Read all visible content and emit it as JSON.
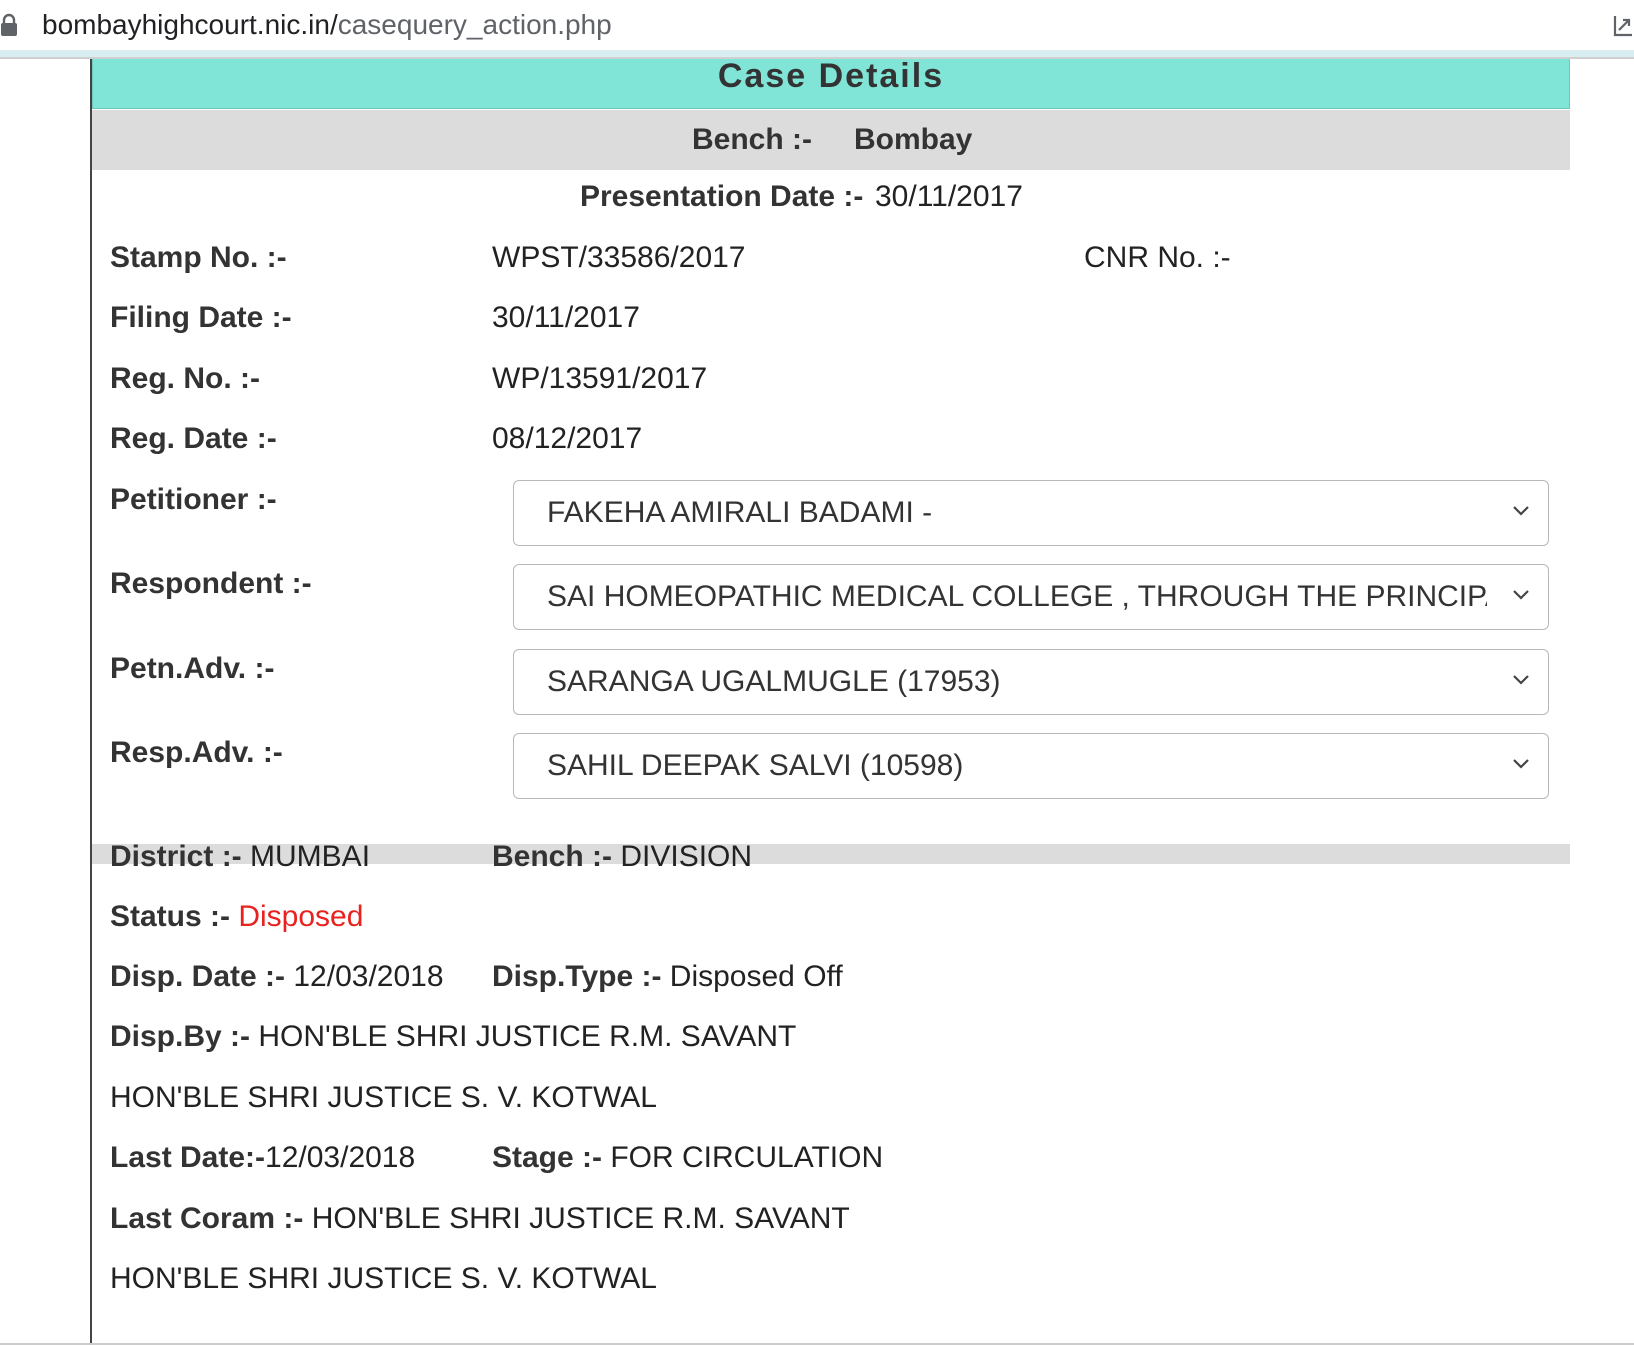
{
  "browser": {
    "url_host": "bombayhighcourt.nic.in/",
    "url_path": "casequery_action.php"
  },
  "page": {
    "title": "Case Details",
    "bench_label": "Bench :-",
    "bench_value": "Bombay",
    "presentation_date_label": "Presentation Date :-",
    "presentation_date_value": "30/11/2017"
  },
  "case": {
    "stamp_no_label": "Stamp No. :-",
    "stamp_no_value": "WPST/33586/2017",
    "cnr_no_label": "CNR No. :-",
    "filing_date_label": "Filing Date :-",
    "filing_date_value": "30/11/2017",
    "reg_no_label": "Reg. No. :-",
    "reg_no_value": "WP/13591/2017",
    "reg_date_label": "Reg. Date :-",
    "reg_date_value": "08/12/2017"
  },
  "parties": {
    "petitioner_label": "Petitioner :-",
    "petitioner_selected": "FAKEHA AMIRALI BADAMI -",
    "respondent_label": "Respondent :-",
    "respondent_selected": "SAI HOMEOPATHIC MEDICAL COLLEGE , THROUGH THE PRINCIPAL",
    "petn_adv_label": "Petn.Adv. :-",
    "petn_adv_selected": "SARANGA UGALMUGLE (17953)",
    "resp_adv_label": "Resp.Adv. :-",
    "resp_adv_selected": "SAHIL DEEPAK SALVI (10598)"
  },
  "status": {
    "district_label": "District :-",
    "district_value": "MUMBAI",
    "bench_label": "Bench :-",
    "bench_value": "DIVISION",
    "status_label": "Status :-",
    "status_value": "Disposed",
    "status_color": "#e8231f",
    "disp_date_label": "Disp. Date :-",
    "disp_date_value": "12/03/2018",
    "disp_type_label": "Disp.Type :-",
    "disp_type_value": "Disposed Off",
    "disp_by_label": "Disp.By :-",
    "disp_by_value_1": "HON'BLE SHRI JUSTICE R.M. SAVANT",
    "disp_by_value_2": "HON'BLE SHRI JUSTICE S. V. KOTWAL",
    "last_date_label": "Last Date:-",
    "last_date_value": "12/03/2018",
    "stage_label": "Stage :-",
    "stage_value": "FOR CIRCULATION",
    "last_coram_label": "Last Coram :-",
    "last_coram_value_1": "HON'BLE SHRI JUSTICE R.M. SAVANT",
    "last_coram_value_2": "HON'BLE SHRI JUSTICE S. V. KOTWAL"
  },
  "colors": {
    "header_bg": "#80e4d6",
    "band_bg": "#dcdcdc"
  }
}
